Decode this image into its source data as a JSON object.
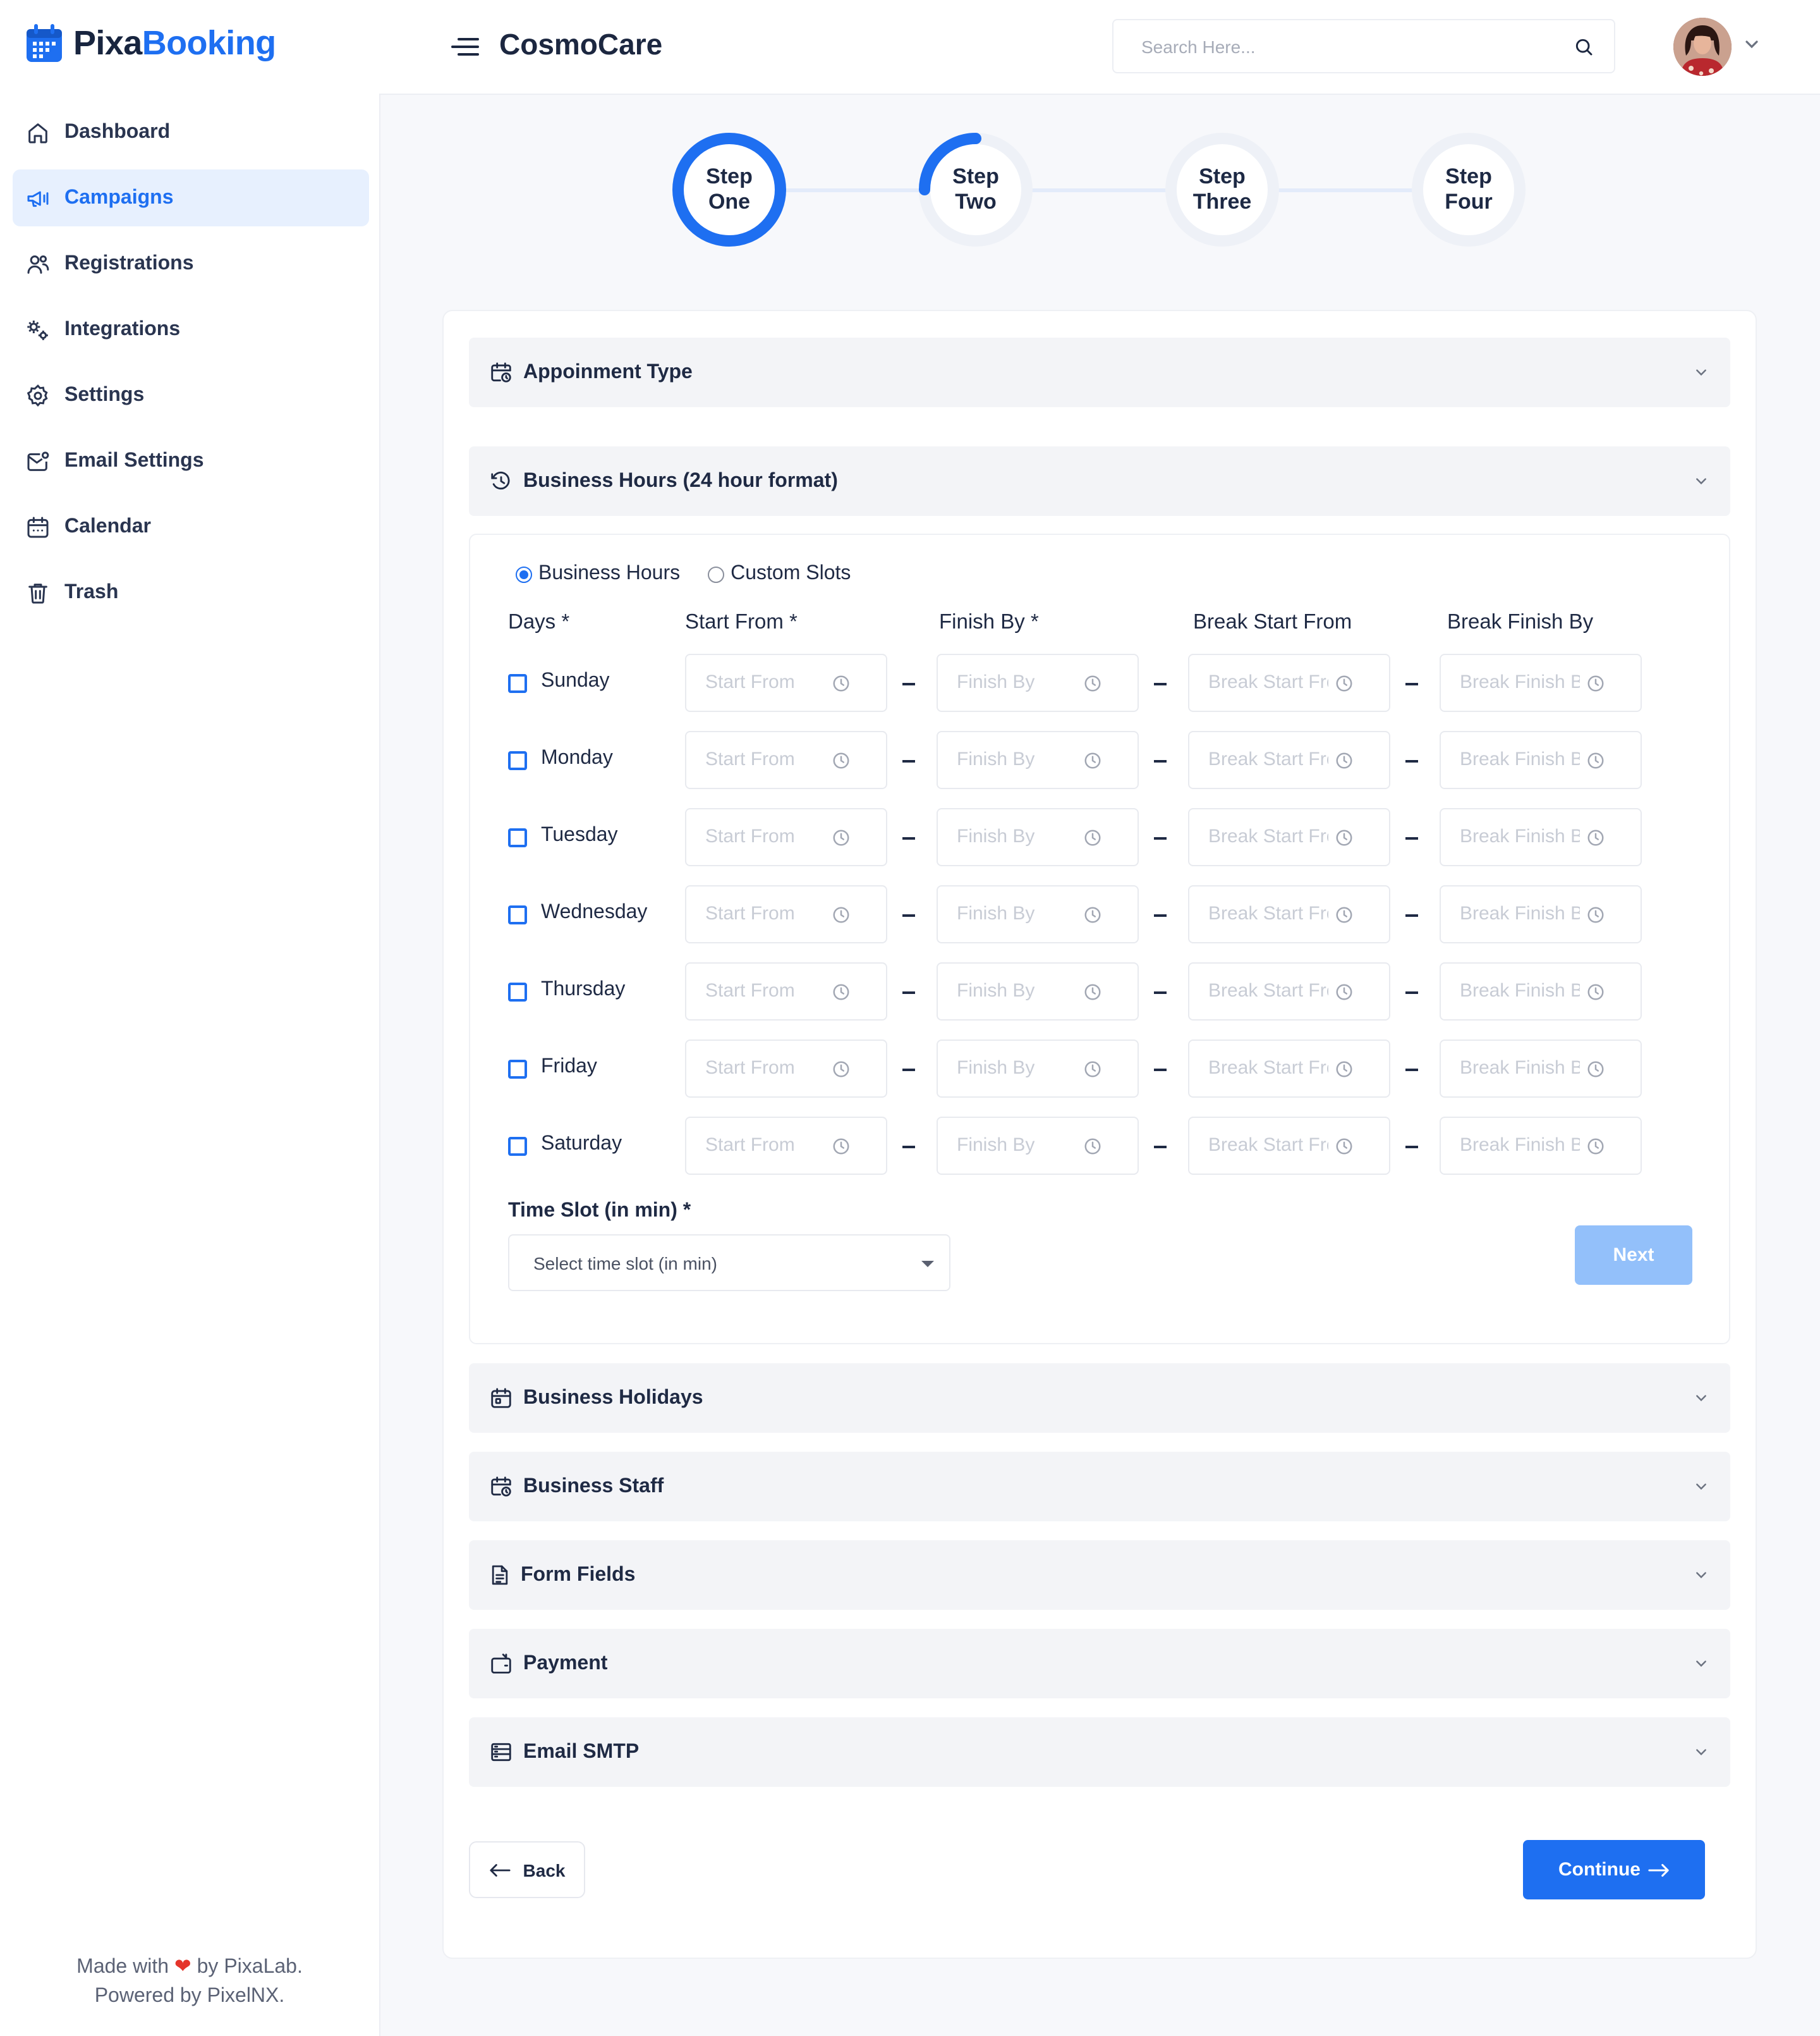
{
  "brand": {
    "logo_part1": "Pixa",
    "logo_part2": "Booking"
  },
  "sidebar": {
    "items": [
      {
        "label": "Dashboard",
        "icon": "home-icon",
        "active": false
      },
      {
        "label": "Campaigns",
        "icon": "megaphone-icon",
        "active": true
      },
      {
        "label": "Registrations",
        "icon": "users-icon",
        "active": false
      },
      {
        "label": "Integrations",
        "icon": "gears-icon",
        "active": false
      },
      {
        "label": "Settings",
        "icon": "gear-icon",
        "active": false
      },
      {
        "label": "Email Settings",
        "icon": "mail-icon",
        "active": false
      },
      {
        "label": "Calendar",
        "icon": "calendar-icon",
        "active": false
      },
      {
        "label": "Trash",
        "icon": "trash-icon",
        "active": false
      }
    ],
    "footer_line1_a": "Made with",
    "footer_line1_b": "by PixaLab.",
    "footer_line2": "Powered by PixelNX."
  },
  "header": {
    "title": "CosmoCare",
    "search_placeholder": "Search Here..."
  },
  "steps": [
    {
      "line1": "Step",
      "line2": "One",
      "progress": 1.0
    },
    {
      "line1": "Step",
      "line2": "Two",
      "progress": 0.25
    },
    {
      "line1": "Step",
      "line2": "Three",
      "progress": 0
    },
    {
      "line1": "Step",
      "line2": "Four",
      "progress": 0
    }
  ],
  "accordions": {
    "appointment_type": "Appoinment Type",
    "business_hours": "Business Hours (24 hour format)",
    "business_holidays": "Business Holidays",
    "business_staff": "Business Staff",
    "form_fields": "Form Fields",
    "payment": "Payment",
    "email_smtp": "Email SMTP"
  },
  "hours": {
    "radio_business": "Business Hours",
    "radio_custom": "Custom Slots",
    "selected_mode": "Business Hours",
    "columns": [
      "Days *",
      "Start From *",
      "Finish By *",
      "Break Start From",
      "Break Finish By"
    ],
    "placeholders": [
      "Start From",
      "Finish By",
      "Break Start From",
      "Break Finish By"
    ],
    "days": [
      "Sunday",
      "Monday",
      "Tuesday",
      "Wednesday",
      "Thursday",
      "Friday",
      "Saturday"
    ],
    "time_slot_label": "Time Slot (in min) *",
    "time_slot_value": "Select time slot (in min)",
    "next_label": "Next"
  },
  "footer_actions": {
    "back_label": "Back",
    "continue_label": "Continue"
  },
  "colors": {
    "accent": "#1e6ff1",
    "accent_light": "#e7f0fe",
    "next_disabled": "#93c0fa"
  }
}
